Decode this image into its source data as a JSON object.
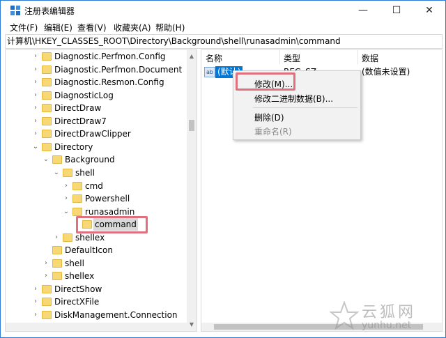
{
  "window": {
    "title": "注册表编辑器",
    "min_glyph": "—",
    "max_glyph": "☐",
    "close_glyph": "✕"
  },
  "menu": [
    "文件(F)",
    "编辑(E)",
    "查看(V)",
    "收藏夹(A)",
    "帮助(H)"
  ],
  "address": "计算机\\HKEY_CLASSES_ROOT\\Directory\\Background\\shell\\runasadmin\\command",
  "tree": [
    {
      "label": "Diagnostic.Perfmon.Config",
      "chevron": "›"
    },
    {
      "label": "Diagnostic.Perfmon.Document",
      "chevron": "›"
    },
    {
      "label": "Diagnostic.Resmon.Config",
      "chevron": "›"
    },
    {
      "label": "DiagnosticLog",
      "chevron": "›"
    },
    {
      "label": "DirectDraw",
      "chevron": "›"
    },
    {
      "label": "DirectDraw7",
      "chevron": "›"
    },
    {
      "label": "DirectDrawClipper",
      "chevron": "›"
    },
    {
      "label": "Directory",
      "chevron": "⌄"
    },
    {
      "label": "Background",
      "chevron": "⌄"
    },
    {
      "label": "shell",
      "chevron": "⌄"
    },
    {
      "label": "cmd",
      "chevron": "›"
    },
    {
      "label": "Powershell",
      "chevron": "›"
    },
    {
      "label": "runasadmin",
      "chevron": "⌄"
    },
    {
      "label": "command",
      "chevron": ""
    },
    {
      "label": "shellex",
      "chevron": "›"
    },
    {
      "label": "DefaultIcon",
      "chevron": ""
    },
    {
      "label": "shell",
      "chevron": "›"
    },
    {
      "label": "shellex",
      "chevron": "›"
    },
    {
      "label": "DirectShow",
      "chevron": "›"
    },
    {
      "label": "DirectXFile",
      "chevron": "›"
    },
    {
      "label": "DiskManagement.Connection",
      "chevron": "›"
    }
  ],
  "columns": {
    "name": "名称",
    "type": "类型",
    "data": "数据"
  },
  "values": [
    {
      "icon": "ab",
      "name": "(默认)",
      "type": "REG_SZ",
      "data": "(数值未设置)"
    }
  ],
  "context_menu": {
    "modify": "修改(M)...",
    "modify_binary": "修改二进制数据(B)...",
    "delete": "删除(D)",
    "rename": "重命名(R)"
  },
  "watermark": {
    "cn": "云狐网",
    "en": "yunhu.net"
  },
  "colors": {
    "selection": "#0078d7",
    "highlight_box": "#e0707d",
    "folder": "#f8d775"
  }
}
